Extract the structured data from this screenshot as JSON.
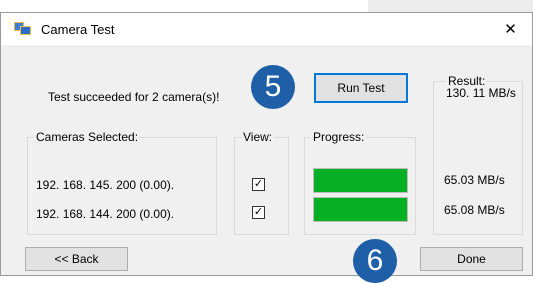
{
  "window": {
    "title": "Camera Test",
    "close_glyph": "✕",
    "icon": "camera-test-app-icon"
  },
  "status": {
    "message": "Test succeeded for 2 camera(s)!"
  },
  "annotations": {
    "step5": "5",
    "step6": "6"
  },
  "buttons": {
    "run_test": "Run Test",
    "back": "<< Back",
    "done": "Done"
  },
  "cameras": {
    "label": "Cameras Selected:",
    "items": [
      {
        "address": "192. 168. 145. 200 (0.00)."
      },
      {
        "address": "192. 168. 144. 200 (0.00)."
      }
    ]
  },
  "view": {
    "label": "View:",
    "checks": [
      true,
      true
    ],
    "check_glyph": "✓"
  },
  "progress": {
    "label": "Progress:",
    "values": [
      1.0,
      1.0
    ],
    "fill_color": "#06b025"
  },
  "result": {
    "label": "Result:",
    "total": "130. 11 MB/s",
    "rates": [
      "65.03 MB/s",
      "65.08 MB/s"
    ]
  },
  "colors": {
    "badge": "#1f5fa8",
    "focus_border": "#0078d7"
  }
}
